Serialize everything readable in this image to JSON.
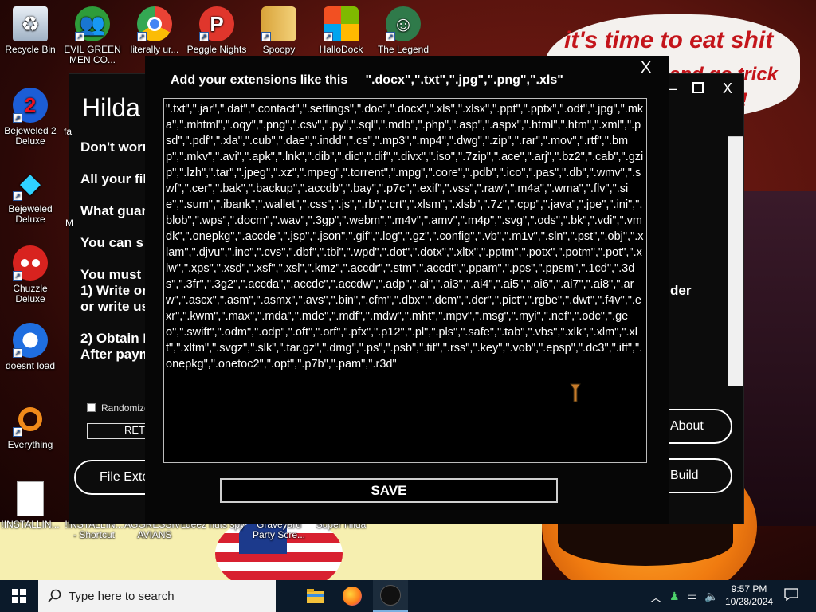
{
  "wallpaper": {
    "caption_main": "it's time to eat shit",
    "caption_fragment": "and go trick",
    "caption_end": "!"
  },
  "desktop_icons": [
    {
      "label": "Recycle Bin",
      "icon": "recycle-bin-icon"
    },
    {
      "label": "EVIL GREEN MEN CO...",
      "icon": "green-men-icon"
    },
    {
      "label": "literally ur...",
      "icon": "chrome-icon"
    },
    {
      "label": "Peggle Nights",
      "icon": "peggle-icon"
    },
    {
      "label": "Spoopy",
      "icon": "folder-icon"
    },
    {
      "label": "HalloDock",
      "icon": "windows-logo-icon"
    },
    {
      "label": "The Legend",
      "icon": "character-icon"
    },
    {
      "label": "Bejeweled 2 Deluxe",
      "icon": "gem-icon"
    },
    {
      "label": "Bejeweled Deluxe",
      "icon": "diamond-icon"
    },
    {
      "label": "Chuzzle Deluxe",
      "icon": "chuzzle-icon"
    },
    {
      "label": "doesnt load",
      "icon": "thunderbird-icon"
    },
    {
      "label": "Everything",
      "icon": "search-magnifier-icon"
    },
    {
      "label": "!INSTALLIN...",
      "icon": "document-icon"
    },
    {
      "label": "!INSTALLIN... - Shortcut",
      "icon": "shortcut-icon"
    },
    {
      "label": "AGGRESSIVE AVIANS",
      "icon": "game-icon"
    },
    {
      "label": "deez nuts spy",
      "icon": "game-icon"
    },
    {
      "label": "Graveyard Party Scre...",
      "icon": "game-icon"
    },
    {
      "label": "Super Hilda",
      "icon": "game-icon"
    }
  ],
  "background_window": {
    "title": "Hilda",
    "lines": [
      "Don't worr",
      "All your file",
      "What guar",
      "You can s",
      "You must",
      "1) Write or",
      "or write us",
      "2) Obtain I",
      "After paym"
    ],
    "right_text": "der",
    "randomize_label": "Randomize",
    "ret_label": "RET",
    "file_ext_button": "File Exter",
    "about_button": "About",
    "build_button": "Build",
    "side_fragments": [
      "fa",
      "M"
    ]
  },
  "dialog": {
    "close_label": "X",
    "heading": "Add your extensions like this     \".docx\",\".txt\",\".jpg\",\".png\",\".xls\"",
    "extensions_text": "\".txt\",\".jar\",\".dat\",\".contact\",\".settings\",\".doc\",\".docx\",\".xls\",\".xlsx\",\".ppt\",\".pptx\",\".odt\",\".jpg\",\".mka\",\".mhtml\",\".oqy\",\".png\",\".csv\",\".py\",\".sql\",\".mdb\",\".php\",\".asp\",\".aspx\",\".html\",\".htm\",\".xml\",\".psd\",\".pdf\",\".xla\",\".cub\",\".dae\",\".indd\",\".cs\",\".mp3\",\".mp4\",\".dwg\",\".zip\",\".rar\",\".mov\",\".rtf\",\".bmp\",\".mkv\",\".avi\",\".apk\",\".lnk\",\".dib\",\".dic\",\".dif\",\".divx\",\".iso\",\".7zip\",\".ace\",\".arj\",\".bz2\",\".cab\",\".gzip\",\".lzh\",\".tar\",\".jpeg\",\".xz\",\".mpeg\",\".torrent\",\".mpg\",\".core\",\".pdb\",\".ico\",\".pas\",\".db\",\".wmv\",\".swf\",\".cer\",\".bak\",\".backup\",\".accdb\",\".bay\",\".p7c\",\".exif\",\".vss\",\".raw\",\".m4a\",\".wma\",\".flv\",\".sie\",\".sum\",\".ibank\",\".wallet\",\".css\",\".js\",\".rb\",\".crt\",\".xlsm\",\".xlsb\",\".7z\",\".cpp\",\".java\",\".jpe\",\".ini\",\".blob\",\".wps\",\".docm\",\".wav\",\".3gp\",\".webm\",\".m4v\",\".amv\",\".m4p\",\".svg\",\".ods\",\".bk\",\".vdi\",\".vmdk\",\".onepkg\",\".accde\",\".jsp\",\".json\",\".gif\",\".log\",\".gz\",\".config\",\".vb\",\".m1v\",\".sln\",\".pst\",\".obj\",\".xlam\",\".djvu\",\".inc\",\".cvs\",\".dbf\",\".tbi\",\".wpd\",\".dot\",\".dotx\",\".xltx\",\".pptm\",\".potx\",\".potm\",\".pot\",\".xlw\",\".xps\",\".xsd\",\".xsf\",\".xsl\",\".kmz\",\".accdr\",\".stm\",\".accdt\",\".ppam\",\".pps\",\".ppsm\",\".1cd\",\".3ds\",\".3fr\",\".3g2\",\".accda\",\".accdc\",\".accdw\",\".adp\",\".ai\",\".ai3\",\".ai4\",\".ai5\",\".ai6\",\".ai7\",\".ai8\",\".arw\",\".ascx\",\".asm\",\".asmx\",\".avs\",\".bin\",\".cfm\",\".dbx\",\".dcm\",\".dcr\",\".pict\",\".rgbe\",\".dwt\",\".f4v\",\".exr\",\".kwm\",\".max\",\".mda\",\".mde\",\".mdf\",\".mdw\",\".mht\",\".mpv\",\".msg\",\".myi\",\".nef\",\".odc\",\".geo\",\".swift\",\".odm\",\".odp\",\".oft\",\".orf\",\".pfx\",\".p12\",\".pl\",\".pls\",\".safe\",\".tab\",\".vbs\",\".xlk\",\".xlm\",\".xlt\",\".xltm\",\".svgz\",\".slk\",\".tar.gz\",\".dmg\",\".ps\",\".psb\",\".tif\",\".rss\",\".key\",\".vob\",\".epsp\",\".dc3\",\".iff\",\".onepkg\",\".onetoc2\",\".opt\",\".p7b\",\".pam\",\".r3d\"",
    "save_label": "SAVE"
  },
  "taskbar": {
    "search_placeholder": "Type here to search",
    "apps": [
      "file-explorer-icon",
      "firefox-icon",
      "crab-app-icon"
    ],
    "time": "9:57 PM",
    "date": "10/28/2024"
  }
}
